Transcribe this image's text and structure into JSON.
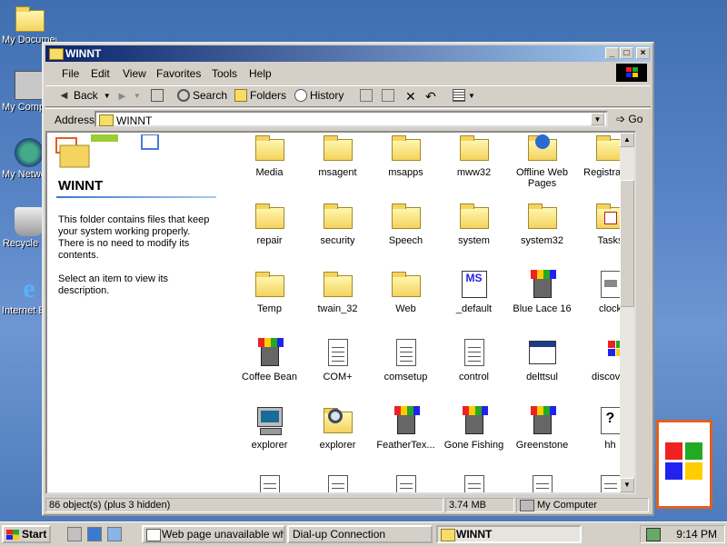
{
  "desktop": {
    "icons": [
      {
        "label": "My Documents",
        "icon": "my-documents-icon"
      },
      {
        "label": "My Computer",
        "icon": "my-computer-icon"
      },
      {
        "label": "My Network Places",
        "icon": "network-places-icon"
      },
      {
        "label": "Recycle Bin",
        "icon": "recycle-bin-icon"
      },
      {
        "label": "Internet Explorer",
        "icon": "internet-explorer-icon"
      }
    ]
  },
  "window": {
    "title": "WINNT",
    "controls": {
      "minimize": "_",
      "maximize": "□",
      "close": "×"
    },
    "menu": [
      "File",
      "Edit",
      "View",
      "Favorites",
      "Tools",
      "Help"
    ],
    "toolbar": {
      "back": "Back",
      "search": "Search",
      "folders": "Folders",
      "history": "History"
    },
    "address": {
      "label": "Address",
      "value": "WINNT",
      "go": "Go"
    }
  },
  "left_pane": {
    "title": "WINNT",
    "description": "This folder contains files that keep your system working properly. There is no need to modify its contents.",
    "hint": "Select an item to view its description."
  },
  "items": [
    {
      "label": "Media",
      "type": "folder"
    },
    {
      "label": "msagent",
      "type": "folder"
    },
    {
      "label": "msapps",
      "type": "folder"
    },
    {
      "label": "mww32",
      "type": "folder"
    },
    {
      "label": "Offline Web Pages",
      "type": "offline-folder"
    },
    {
      "label": "Registration",
      "type": "folder"
    },
    {
      "label": "repair",
      "type": "folder"
    },
    {
      "label": "security",
      "type": "folder"
    },
    {
      "label": "Speech",
      "type": "folder"
    },
    {
      "label": "system",
      "type": "folder"
    },
    {
      "label": "system32",
      "type": "folder"
    },
    {
      "label": "Tasks",
      "type": "tasks-folder"
    },
    {
      "label": "Temp",
      "type": "folder"
    },
    {
      "label": "twain_32",
      "type": "folder"
    },
    {
      "label": "Web",
      "type": "folder"
    },
    {
      "label": "_default",
      "type": "ms-app"
    },
    {
      "label": "Blue Lace 16",
      "type": "paint"
    },
    {
      "label": "clock",
      "type": "clock"
    },
    {
      "label": "Coffee Bean",
      "type": "paint"
    },
    {
      "label": "COM+",
      "type": "doc"
    },
    {
      "label": "comsetup",
      "type": "doc"
    },
    {
      "label": "control",
      "type": "doc"
    },
    {
      "label": "delttsul",
      "type": "app"
    },
    {
      "label": "discover",
      "type": "discover"
    },
    {
      "label": "explorer",
      "type": "computer"
    },
    {
      "label": "explorer",
      "type": "search-folder"
    },
    {
      "label": "FeatherTex...",
      "type": "paint"
    },
    {
      "label": "Gone Fishing",
      "type": "paint"
    },
    {
      "label": "Greenstone",
      "type": "paint"
    },
    {
      "label": "hh",
      "type": "help"
    },
    {
      "label": "",
      "type": "doc"
    },
    {
      "label": "",
      "type": "doc"
    },
    {
      "label": "",
      "type": "doc"
    },
    {
      "label": "",
      "type": "doc"
    },
    {
      "label": "",
      "type": "doc"
    },
    {
      "label": "",
      "type": "doc"
    }
  ],
  "status": {
    "objects": "86 object(s) (plus 3 hidden)",
    "size": "3.74 MB",
    "zone": "My Computer"
  },
  "taskbar": {
    "start": "Start",
    "buttons": [
      {
        "label": "Web page unavailable wh..."
      },
      {
        "label": "Dial-up Connection"
      },
      {
        "label": "WINNT"
      }
    ],
    "clock": "9:14 PM"
  }
}
